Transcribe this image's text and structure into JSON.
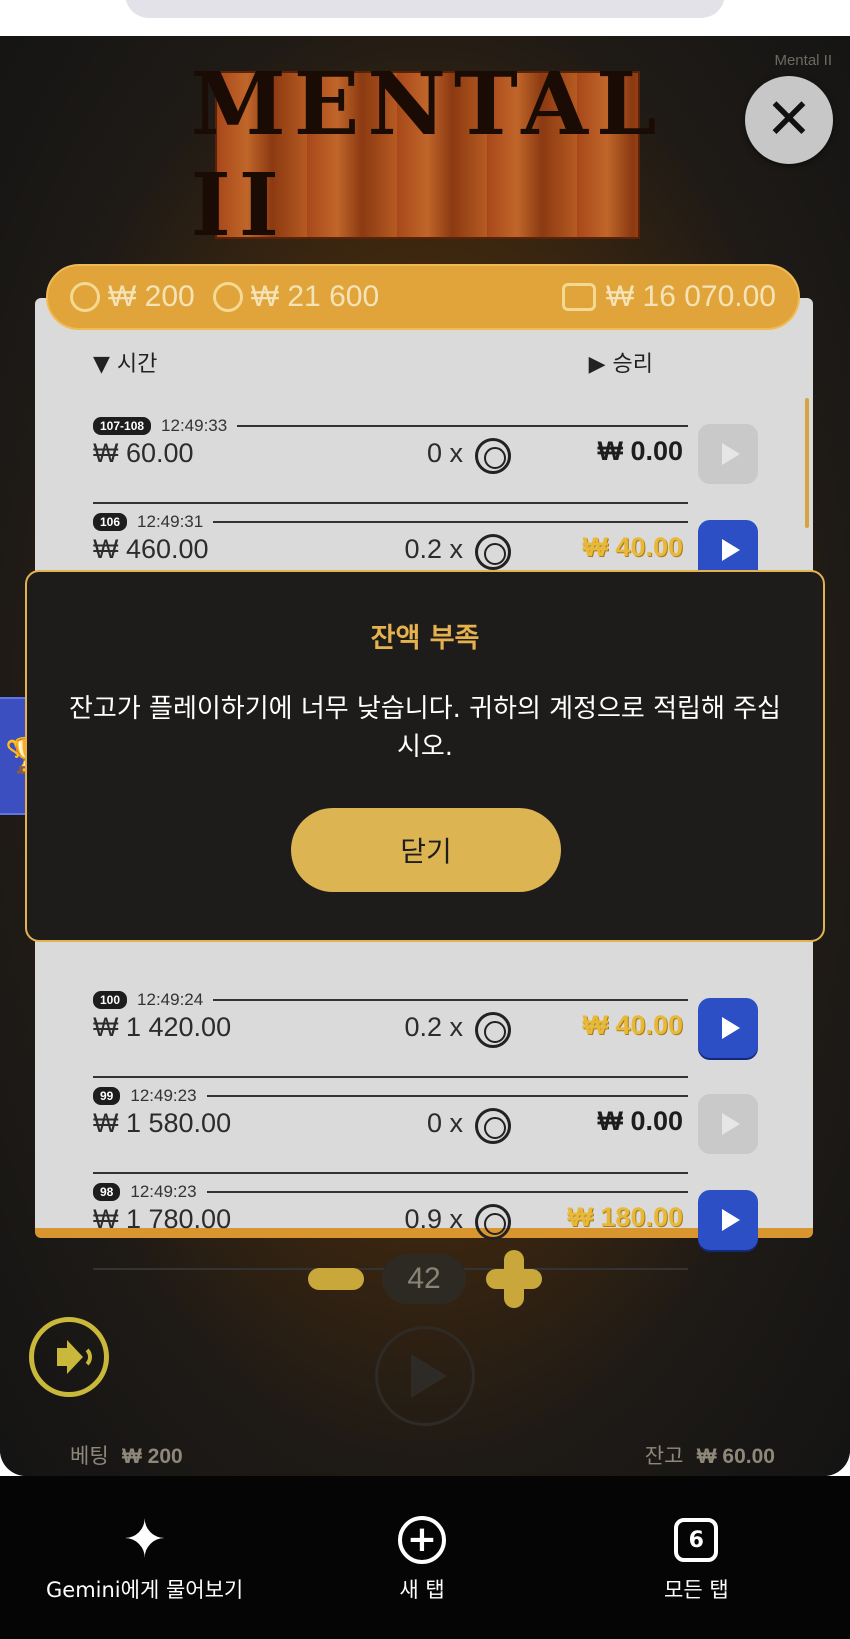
{
  "game": {
    "name": "Mental II",
    "logo_text": "MENTAL II"
  },
  "stats": {
    "bet": "₩ 200",
    "max_win": "₩ 21 600",
    "wallet": "₩ 16 070.00"
  },
  "history": {
    "col_time": "▼ 시간",
    "col_win": "▶ 승리",
    "rows": [
      {
        "badge": "107-108",
        "time": "12:49:33",
        "bet": "₩ 60.00",
        "mult": "0 x",
        "win": "₩ 0.00",
        "win_style": "zero",
        "replay": false
      },
      {
        "badge": "106",
        "time": "12:49:31",
        "bet": "₩ 460.00",
        "mult": "0.2 x",
        "win": "₩ 40.00",
        "win_style": "gold",
        "replay": true
      },
      {
        "badge": "100",
        "time": "12:49:24",
        "bet": "₩ 1 420.00",
        "mult": "0.2 x",
        "win": "₩ 40.00",
        "win_style": "gold",
        "replay": true
      },
      {
        "badge": "99",
        "time": "12:49:23",
        "bet": "₩ 1 580.00",
        "mult": "0 x",
        "win": "₩ 0.00",
        "win_style": "zero",
        "replay": false
      },
      {
        "badge": "98",
        "time": "12:49:23",
        "bet": "₩ 1 780.00",
        "mult": "0.9 x",
        "win": "₩ 180.00",
        "win_style": "gold",
        "replay": true
      }
    ]
  },
  "controls": {
    "count": "42",
    "bet_label": "베팅",
    "bet_value": "₩ 200",
    "balance_label": "잔고",
    "balance_value": "₩ 60.00"
  },
  "modal": {
    "title": "잔액 부족",
    "message": "잔고가 플레이하기에 너무 낮습니다. 귀하의 계정으로 적립해 주십시오.",
    "button": "닫기"
  },
  "nav": {
    "gemini": "Gemini에게 물어보기",
    "new_tab": "새 탭",
    "all_tabs": "모든 탭",
    "tab_count": "6"
  }
}
